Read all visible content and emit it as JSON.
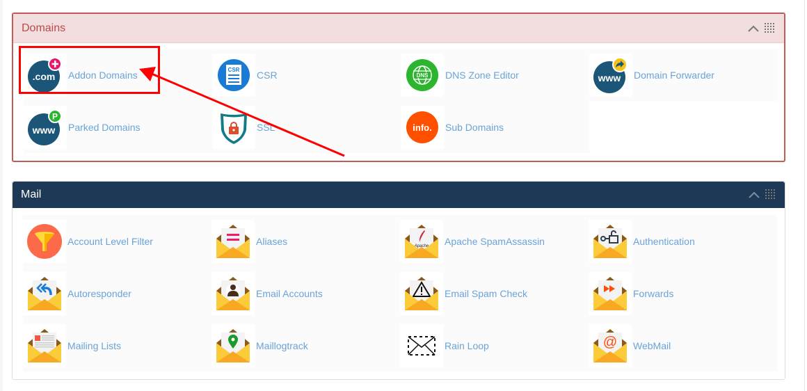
{
  "domains_panel": {
    "title": "Domains",
    "items": [
      {
        "label": "Addon Domains",
        "icon": "addon-domains-icon"
      },
      {
        "label": "CSR",
        "icon": "csr-icon"
      },
      {
        "label": "DNS Zone Editor",
        "icon": "dns-zone-editor-icon"
      },
      {
        "label": "Domain Forwarder",
        "icon": "domain-forwarder-icon"
      },
      {
        "label": "Parked Domains",
        "icon": "parked-domains-icon"
      },
      {
        "label": "SSL",
        "icon": "ssl-icon"
      },
      {
        "label": "Sub Domains",
        "icon": "sub-domains-icon"
      }
    ],
    "icon_text": {
      "com": ".com",
      "csr": "CSR",
      "dns": "DNS",
      "www": "www",
      "p": "P",
      "info": "info."
    }
  },
  "mail_panel": {
    "title": "Mail",
    "items": [
      {
        "label": "Account Level Filter",
        "icon": "funnel-icon"
      },
      {
        "label": "Aliases",
        "icon": "aliases-icon"
      },
      {
        "label": "Apache SpamAssassin",
        "icon": "spamassassin-icon"
      },
      {
        "label": "Authentication",
        "icon": "authentication-icon"
      },
      {
        "label": "Autoresponder",
        "icon": "autoresponder-icon"
      },
      {
        "label": "Email Accounts",
        "icon": "email-accounts-icon"
      },
      {
        "label": "Email Spam Check",
        "icon": "spam-check-icon"
      },
      {
        "label": "Forwards",
        "icon": "forwards-icon"
      },
      {
        "label": "Mailing Lists",
        "icon": "mailing-lists-icon"
      },
      {
        "label": "Maillogtrack",
        "icon": "maillogtrack-icon"
      },
      {
        "label": "Rain Loop",
        "icon": "rain-loop-icon"
      },
      {
        "label": "WebMail",
        "icon": "webmail-icon"
      }
    ],
    "icon_text": {
      "apache": "Apache",
      "at": "@"
    }
  },
  "colors": {
    "domains_header_bg": "#f2dede",
    "domains_header_text": "#b94a48",
    "mail_header_bg": "#1d3956",
    "link_text": "#6aa3d8",
    "annotation_red": "#ff0000"
  }
}
